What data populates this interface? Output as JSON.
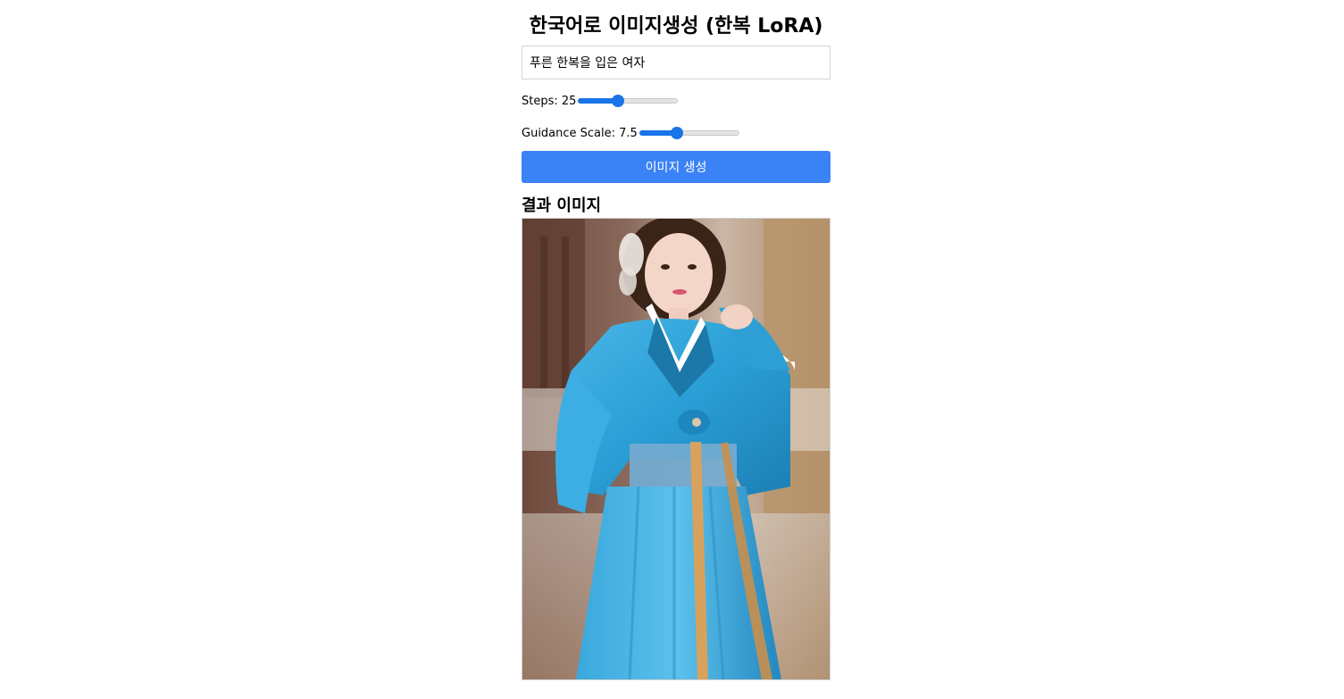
{
  "page": {
    "title": "한국어로 이미지생성 (한복 LoRA)"
  },
  "prompt": {
    "value": "푸른 한복을 입은 여자"
  },
  "steps": {
    "label": "Steps: 25",
    "value": 25,
    "fraction": 0.38
  },
  "guidance": {
    "label": "Guidance Scale: 7.5",
    "value": 7.5,
    "fraction": 0.36
  },
  "generate_button": {
    "label": "이미지 생성"
  },
  "result": {
    "heading": "결과 이미지"
  },
  "colors": {
    "accent": "#1a73e8",
    "button": "#3b82f6"
  }
}
